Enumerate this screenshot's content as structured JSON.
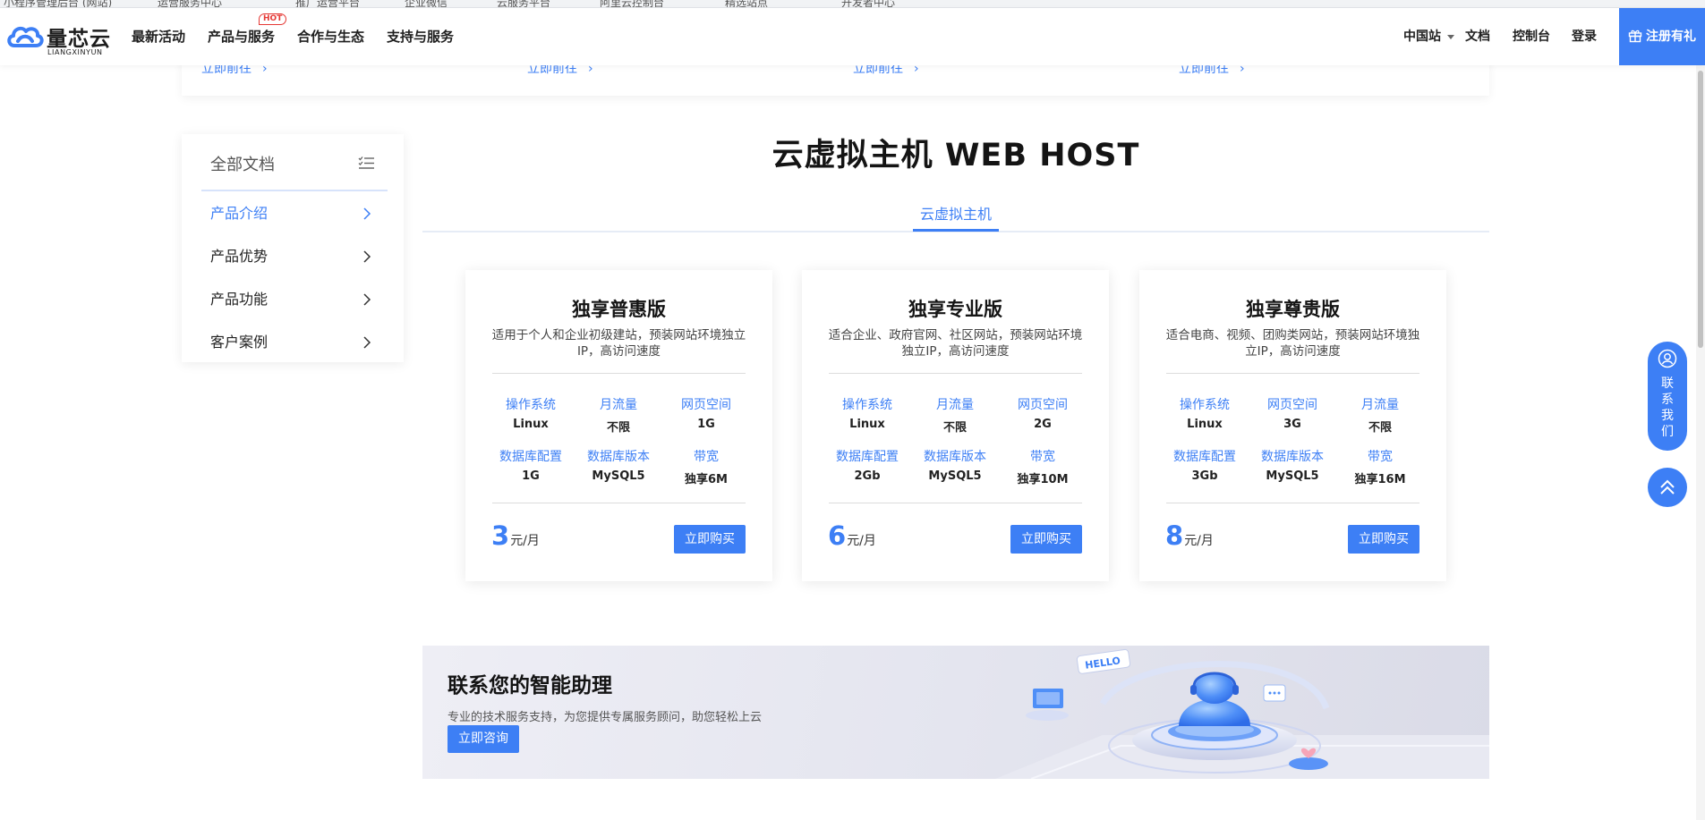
{
  "browser": {
    "bookmarks": [
      "小程序管理后台 (网站)",
      "运营服务中心",
      "推广运营平台",
      "企业微信",
      "云服务平台",
      "阿里云控制台",
      "精选站点",
      "开发者中心"
    ]
  },
  "header": {
    "logo_name": "量芯云",
    "logo_sub": "LIANGXINYUN",
    "nav": [
      {
        "label": "最新活动"
      },
      {
        "label": "产品与服务",
        "badge": "HOT"
      },
      {
        "label": "合作与生态"
      },
      {
        "label": "支持与服务"
      }
    ],
    "site_selector": "中国站",
    "docs": "文档",
    "console": "控制台",
    "login": "登录",
    "register": "注册有礼"
  },
  "links_band": {
    "links": [
      "立即前往",
      "立即前往",
      "立即前往",
      "立即前往"
    ]
  },
  "sidebar": {
    "title": "全部文档",
    "items": [
      {
        "label": "产品介绍",
        "active": true
      },
      {
        "label": "产品优势",
        "active": false
      },
      {
        "label": "产品功能",
        "active": false
      },
      {
        "label": "客户案例",
        "active": false
      }
    ]
  },
  "main": {
    "title": "云虚拟主机 WEB HOST",
    "tab": "云虚拟主机"
  },
  "plans": [
    {
      "name": "独享普惠版",
      "desc": "适用于个人和企业初级建站，预装网站环境独立IP，高访问速度",
      "specs_row1": [
        {
          "label": "操作系统",
          "value": "Linux"
        },
        {
          "label": "月流量",
          "value": "不限"
        },
        {
          "label": "网页空间",
          "value": "1G"
        }
      ],
      "specs_row2": [
        {
          "label": "数据库配置",
          "value": "1G"
        },
        {
          "label": "数据库版本",
          "value": "MySQL5"
        },
        {
          "label": "带宽",
          "value": "独享6M"
        }
      ],
      "price": "3",
      "unit": "元/月",
      "buy": "立即购买"
    },
    {
      "name": "独享专业版",
      "desc": "适合企业、政府官网、社区网站，预装网站环境独立IP，高访问速度",
      "specs_row1": [
        {
          "label": "操作系统",
          "value": "Linux"
        },
        {
          "label": "月流量",
          "value": "不限"
        },
        {
          "label": "网页空间",
          "value": "2G"
        }
      ],
      "specs_row2": [
        {
          "label": "数据库配置",
          "value": "2Gb"
        },
        {
          "label": "数据库版本",
          "value": "MySQL5"
        },
        {
          "label": "带宽",
          "value": "独享10M"
        }
      ],
      "price": "6",
      "unit": "元/月",
      "buy": "立即购买"
    },
    {
      "name": "独享尊贵版",
      "desc": "适合电商、视频、团购类网站，预装网站环境独立IP，高访问速度",
      "specs_row1": [
        {
          "label": "操作系统",
          "value": "Linux"
        },
        {
          "label": "网页空间",
          "value": "3G"
        },
        {
          "label": "月流量",
          "value": "不限"
        }
      ],
      "specs_row2": [
        {
          "label": "数据库配置",
          "value": "3Gb"
        },
        {
          "label": "数据库版本",
          "value": "MySQL5"
        },
        {
          "label": "带宽",
          "value": "独享16M"
        }
      ],
      "price": "8",
      "unit": "元/月",
      "buy": "立即购买"
    }
  ],
  "assistant": {
    "title": "联系您的智能助理",
    "subtitle": "专业的技术服务支持，为您提供专属服务顾问，助您轻松上云",
    "button": "立即咨询",
    "art_text": "HELLO"
  },
  "float": {
    "contact": "联系我们"
  },
  "colors": {
    "accent": "#3d7ff5",
    "hot": "#e53935"
  }
}
